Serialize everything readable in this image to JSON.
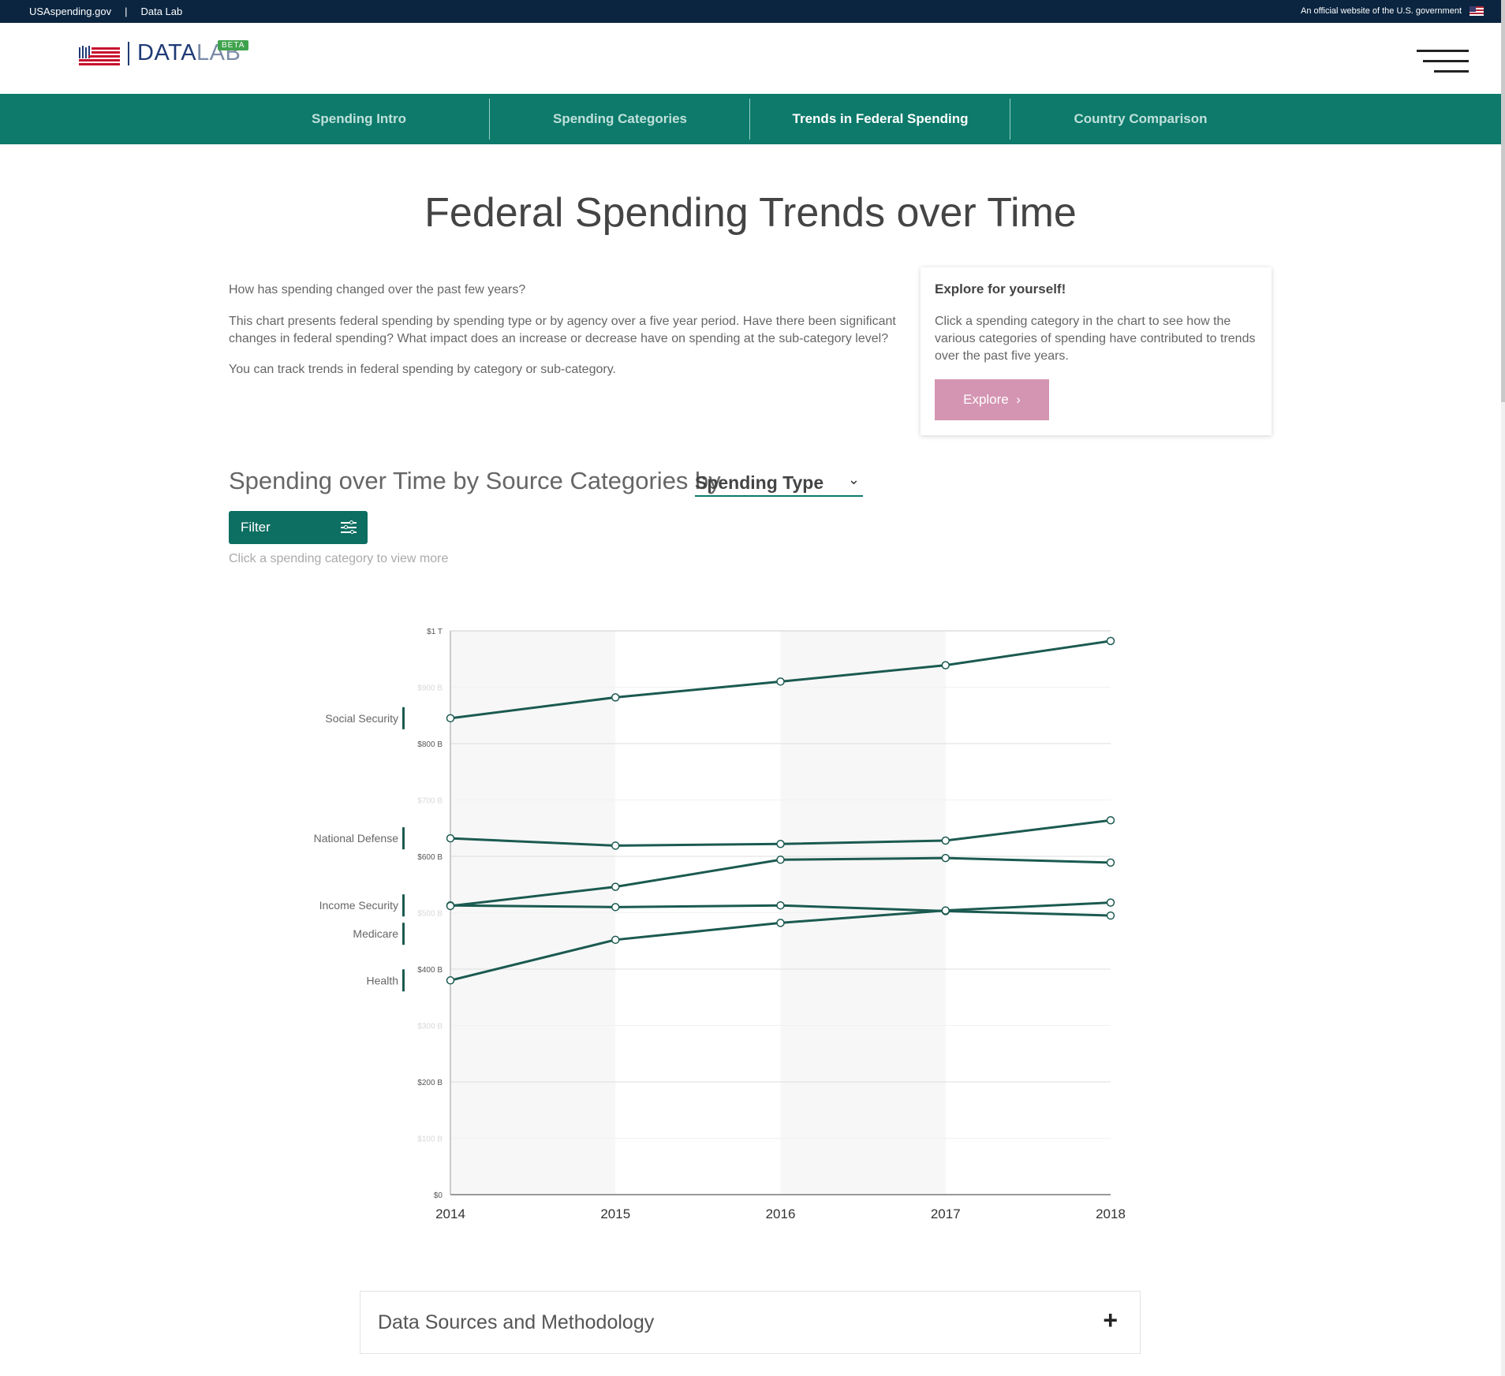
{
  "govbar": {
    "site_link": "USAspending.gov",
    "separator": "|",
    "section_link": "Data Lab",
    "official_text": "An official website of the U.S. government"
  },
  "header": {
    "logo_data": "DATA",
    "logo_lab": "LAB",
    "beta": "BETA"
  },
  "nav": {
    "items": [
      {
        "label": "Spending Intro",
        "active": false
      },
      {
        "label": "Spending Categories",
        "active": false
      },
      {
        "label": "Trends in Federal Spending",
        "active": true
      },
      {
        "label": "Country Comparison",
        "active": false
      }
    ]
  },
  "page": {
    "title": "Federal Spending Trends over Time",
    "intro_1": "How has spending changed over the past few years?",
    "intro_2": "This chart presents federal spending by spending type or by agency over a five year period. Have there been significant changes in federal spending? What impact does an increase or decrease have on spending at the sub-category level?",
    "intro_3": "You can track trends in federal spending by category or sub-category."
  },
  "explore": {
    "heading": "Explore for yourself!",
    "body": "Click a spending category in the chart to see how the various categories of spending have contributed to trends over the past five years.",
    "button": "Explore",
    "button_color": "#d495b2"
  },
  "chart_section": {
    "heading": "Spending over Time by Source Categories by",
    "select_value": "Spending Type",
    "filter_label": "Filter",
    "hint": "Click a spending category to view more"
  },
  "chart_data": {
    "type": "line",
    "x": [
      2014,
      2015,
      2016,
      2017,
      2018
    ],
    "y_ticks": [
      "$0",
      "$100 B",
      "$200 B",
      "$300 B",
      "$400 B",
      "$500 B",
      "$600 B",
      "$700 B",
      "$800 B",
      "$900 B",
      "$1 T"
    ],
    "y_tick_values": [
      0,
      100,
      200,
      300,
      400,
      500,
      600,
      700,
      800,
      900,
      1000
    ],
    "ylim": [
      0,
      1000
    ],
    "y_unit": "billions USD",
    "line_color": "#1b5a50",
    "series": [
      {
        "name": "Social Security",
        "values": [
          845,
          882,
          910,
          939,
          982
        ]
      },
      {
        "name": "National Defense",
        "values": [
          632,
          619,
          622,
          628,
          664
        ]
      },
      {
        "name": "Income Security",
        "values": [
          513,
          510,
          513,
          503,
          495
        ]
      },
      {
        "name": "Medicare",
        "values": [
          512,
          546,
          594,
          597,
          589
        ]
      },
      {
        "name": "Health",
        "values": [
          380,
          452,
          482,
          504,
          518
        ]
      }
    ]
  },
  "accordion": {
    "label": "Data Sources and Methodology",
    "toggle": "+"
  }
}
